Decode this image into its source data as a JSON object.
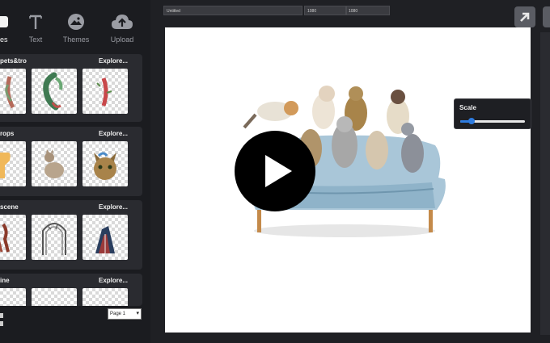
{
  "tabs": [
    {
      "label": "Shapes",
      "visible_label": "es",
      "icon": "shapes-icon",
      "active": true
    },
    {
      "label": "Text",
      "icon": "text-icon",
      "active": false
    },
    {
      "label": "Themes",
      "icon": "themes-icon",
      "active": false
    },
    {
      "label": "Upload",
      "icon": "upload-icon",
      "active": false
    }
  ],
  "panels": [
    {
      "title": "pets&tro",
      "explore": "Explore..."
    },
    {
      "title": "rops",
      "explore": "Explore..."
    },
    {
      "title": "scene",
      "explore": "Explore..."
    },
    {
      "title": "ine",
      "explore": "Explore..."
    }
  ],
  "page_select": {
    "value": "Page 1"
  },
  "topbar": {
    "name_value": "Untitled",
    "width_value": "1080",
    "height_value": "1080"
  },
  "scale": {
    "label": "Scale",
    "value": 0.18
  },
  "colors": {
    "accent": "#2d7be0",
    "bg": "#1f2024",
    "panel": "#2a2b30"
  }
}
